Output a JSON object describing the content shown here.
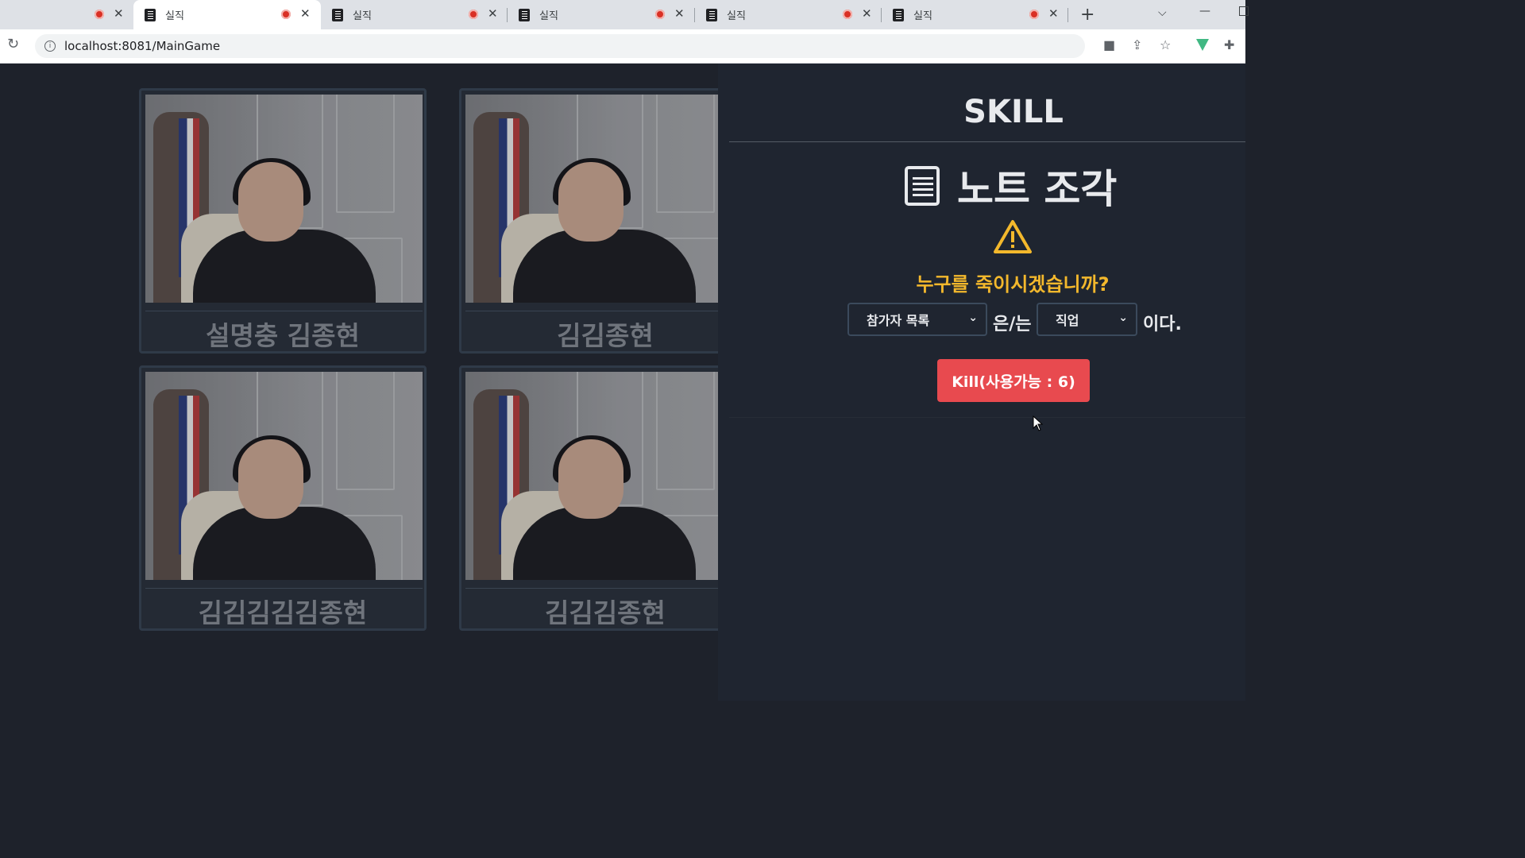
{
  "browser": {
    "tabs": [
      {
        "title": "",
        "active": false
      },
      {
        "title": "실직",
        "active": true
      },
      {
        "title": "실직",
        "active": false
      },
      {
        "title": "실직",
        "active": false
      },
      {
        "title": "실직",
        "active": false
      },
      {
        "title": "실직",
        "active": false
      }
    ],
    "url": "localhost:8081/MainGame"
  },
  "players": [
    {
      "name": "설명충 김종현"
    },
    {
      "name": "김김종현"
    },
    {
      "name": "김김김김김종현"
    },
    {
      "name": "김김김종현"
    }
  ],
  "skill": {
    "title": "SKILL",
    "ability_name": "노트 조각",
    "question": "누구를 죽이시겠습니까?",
    "participant_select": "참가자 목록",
    "connector": "은/는",
    "job_select": "직업",
    "suffix": "이다.",
    "kill_button": "Kill(사용가능 : 6)",
    "colors": {
      "question": "#f3b82c",
      "kill": "#e84a4f",
      "warning": "#f3b82c"
    }
  }
}
